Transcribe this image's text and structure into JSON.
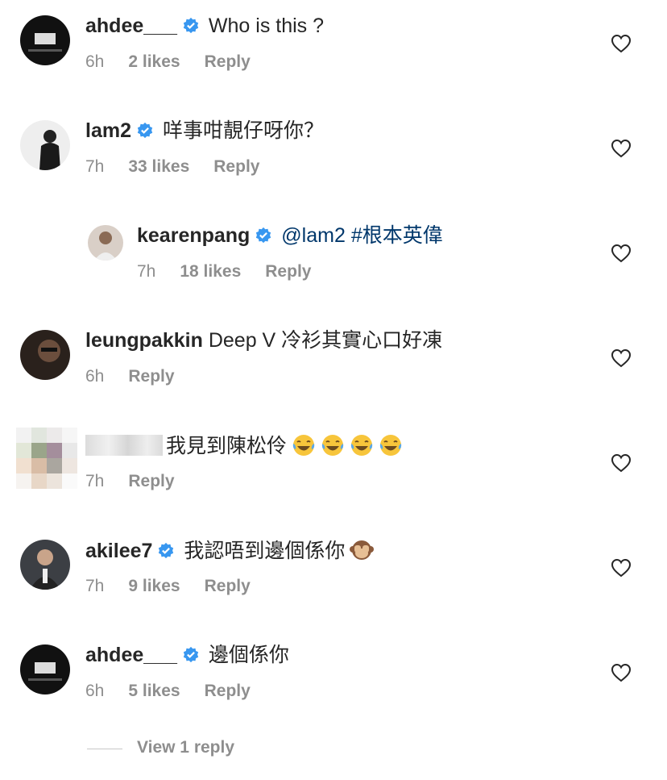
{
  "comments": [
    {
      "user": "ahdee___",
      "verified": true,
      "text": "Who is this ?",
      "time": "6h",
      "likes": "2 likes",
      "reply": "Reply"
    },
    {
      "user": "lam2",
      "verified": true,
      "text": "咩事咁靚仔呀你？",
      "time": "7h",
      "likes": "33 likes",
      "reply": "Reply"
    },
    {
      "user": "kearenpang",
      "verified": true,
      "mention": "@lam2",
      "text": "#根本英偉",
      "time": "7h",
      "likes": "18 likes",
      "reply": "Reply"
    },
    {
      "user": "leungpakkin",
      "verified": false,
      "text": "Deep V 冷衫其實心口好凍",
      "time": "6h",
      "reply": "Reply"
    },
    {
      "user": "",
      "verified": false,
      "text": "我見到陳松伶",
      "time": "7h",
      "reply": "Reply",
      "emoji": "laughing-crying-emoji"
    },
    {
      "user": "akilee7",
      "verified": true,
      "text": "我認唔到邊個係你",
      "time": "7h",
      "likes": "9 likes",
      "reply": "Reply",
      "emoji": "see-no-evil-monkey-emoji"
    },
    {
      "user": "ahdee___",
      "verified": true,
      "text": "邊個係你",
      "time": "6h",
      "likes": "5 likes",
      "reply": "Reply"
    }
  ],
  "view_replies": "View 1 reply",
  "colors": {
    "text": "#262626",
    "meta": "#8e8e8e",
    "verified": "#3897f0",
    "mention": "#00376b"
  }
}
